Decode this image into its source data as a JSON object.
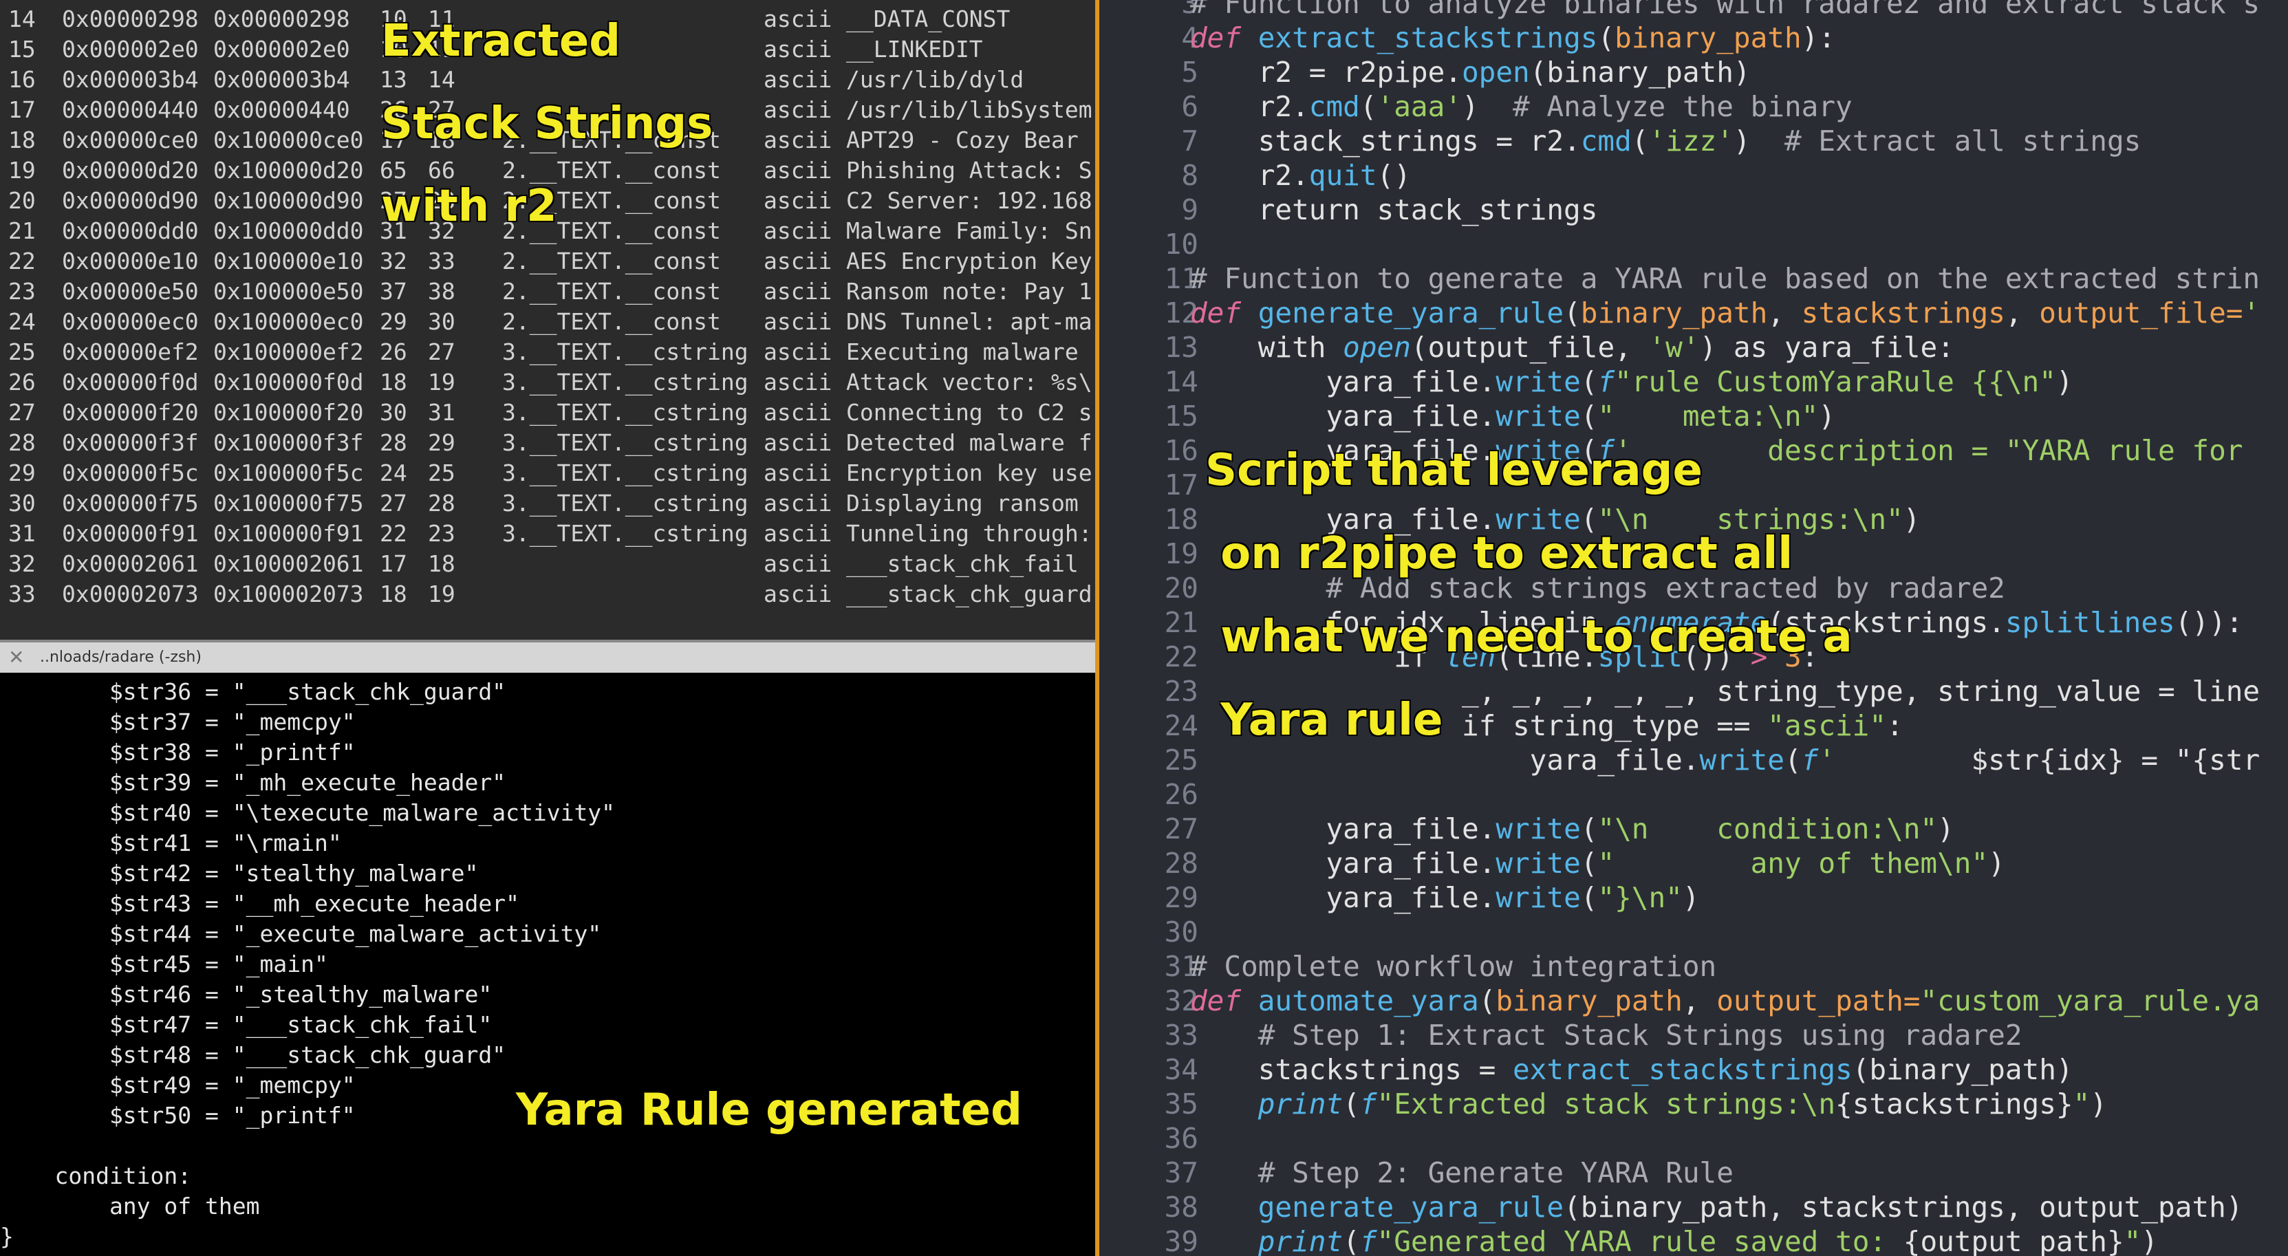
{
  "strings_table": {
    "rows": [
      {
        "idx": "14",
        "paddr": "0x00000298",
        "vaddr": "0x00000298",
        "len": "10",
        "size": "11",
        "section": "",
        "type": "ascii",
        "string": "__DATA_CONST"
      },
      {
        "idx": "15",
        "paddr": "0x000002e0",
        "vaddr": "0x000002e0",
        "len": "10",
        "size": "11",
        "section": "",
        "type": "ascii",
        "string": "__LINKEDIT"
      },
      {
        "idx": "16",
        "paddr": "0x000003b4",
        "vaddr": "0x000003b4",
        "len": "13",
        "size": "14",
        "section": "",
        "type": "ascii",
        "string": "/usr/lib/dyld"
      },
      {
        "idx": "17",
        "paddr": "0x00000440",
        "vaddr": "0x00000440",
        "len": "26",
        "size": "27",
        "section": "",
        "type": "ascii",
        "string": "/usr/lib/libSystem"
      },
      {
        "idx": "18",
        "paddr": "0x00000ce0",
        "vaddr": "0x100000ce0",
        "len": "17",
        "size": "18",
        "section": "2.__TEXT.__const",
        "type": "ascii",
        "string": "APT29 - Cozy Bear"
      },
      {
        "idx": "19",
        "paddr": "0x00000d20",
        "vaddr": "0x100000d20",
        "len": "65",
        "size": "66",
        "section": "2.__TEXT.__const",
        "type": "ascii",
        "string": "Phishing Attack: S"
      },
      {
        "idx": "20",
        "paddr": "0x00000d90",
        "vaddr": "0x100000d90",
        "len": "27",
        "size": "28",
        "section": "2.__TEXT.__const",
        "type": "ascii",
        "string": "C2 Server: 192.168"
      },
      {
        "idx": "21",
        "paddr": "0x00000dd0",
        "vaddr": "0x100000dd0",
        "len": "31",
        "size": "32",
        "section": "2.__TEXT.__const",
        "type": "ascii",
        "string": "Malware Family: Sn"
      },
      {
        "idx": "22",
        "paddr": "0x00000e10",
        "vaddr": "0x100000e10",
        "len": "32",
        "size": "33",
        "section": "2.__TEXT.__const",
        "type": "ascii",
        "string": "AES Encryption Key"
      },
      {
        "idx": "23",
        "paddr": "0x00000e50",
        "vaddr": "0x100000e50",
        "len": "37",
        "size": "38",
        "section": "2.__TEXT.__const",
        "type": "ascii",
        "string": "Ransom note: Pay 1"
      },
      {
        "idx": "24",
        "paddr": "0x00000ec0",
        "vaddr": "0x100000ec0",
        "len": "29",
        "size": "30",
        "section": "2.__TEXT.__const",
        "type": "ascii",
        "string": "DNS Tunnel: apt-ma"
      },
      {
        "idx": "25",
        "paddr": "0x00000ef2",
        "vaddr": "0x100000ef2",
        "len": "26",
        "size": "27",
        "section": "3.__TEXT.__cstring",
        "type": "ascii",
        "string": "Executing malware"
      },
      {
        "idx": "26",
        "paddr": "0x00000f0d",
        "vaddr": "0x100000f0d",
        "len": "18",
        "size": "19",
        "section": "3.__TEXT.__cstring",
        "type": "ascii",
        "string": "Attack vector: %s\\"
      },
      {
        "idx": "27",
        "paddr": "0x00000f20",
        "vaddr": "0x100000f20",
        "len": "30",
        "size": "31",
        "section": "3.__TEXT.__cstring",
        "type": "ascii",
        "string": "Connecting to C2 s"
      },
      {
        "idx": "28",
        "paddr": "0x00000f3f",
        "vaddr": "0x100000f3f",
        "len": "28",
        "size": "29",
        "section": "3.__TEXT.__cstring",
        "type": "ascii",
        "string": "Detected malware f"
      },
      {
        "idx": "29",
        "paddr": "0x00000f5c",
        "vaddr": "0x100000f5c",
        "len": "24",
        "size": "25",
        "section": "3.__TEXT.__cstring",
        "type": "ascii",
        "string": "Encryption key use"
      },
      {
        "idx": "30",
        "paddr": "0x00000f75",
        "vaddr": "0x100000f75",
        "len": "27",
        "size": "28",
        "section": "3.__TEXT.__cstring",
        "type": "ascii",
        "string": "Displaying ransom"
      },
      {
        "idx": "31",
        "paddr": "0x00000f91",
        "vaddr": "0x100000f91",
        "len": "22",
        "size": "23",
        "section": "3.__TEXT.__cstring",
        "type": "ascii",
        "string": "Tunneling through:"
      },
      {
        "idx": "32",
        "paddr": "0x00002061",
        "vaddr": "0x100002061",
        "len": "17",
        "size": "18",
        "section": "",
        "type": "ascii",
        "string": "___stack_chk_fail"
      },
      {
        "idx": "33",
        "paddr": "0x00002073",
        "vaddr": "0x100002073",
        "len": "18",
        "size": "19",
        "section": "",
        "type": "ascii",
        "string": "___stack_chk_guard"
      }
    ]
  },
  "terminal": {
    "title": "..nloads/radare (-zsh)",
    "close_glyph": "✕",
    "lines": [
      "        $str36 = \"___stack_chk_guard\"",
      "        $str37 = \"_memcpy\"",
      "        $str38 = \"_printf\"",
      "        $str39 = \"_mh_execute_header\"",
      "        $str40 = \"\\texecute_malware_activity\"",
      "        $str41 = \"\\rmain\"",
      "        $str42 = \"stealthy_malware\"",
      "        $str43 = \"__mh_execute_header\"",
      "        $str44 = \"_execute_malware_activity\"",
      "        $str45 = \"_main\"",
      "        $str46 = \"_stealthy_malware\"",
      "        $str47 = \"___stack_chk_fail\"",
      "        $str48 = \"___stack_chk_guard\"",
      "        $str49 = \"_memcpy\"",
      "        $str50 = \"_printf\"",
      "",
      "    condition:",
      "        any of them",
      "}"
    ]
  },
  "editor": {
    "lines": [
      {
        "n": "3",
        "t": [
          [
            "cmt",
            "# Function to analyze binaries with radare2 and extract stack s"
          ]
        ]
      },
      {
        "n": "4",
        "t": [
          [
            "kw",
            "def "
          ],
          [
            "fn",
            "extract_stackstrings"
          ],
          [
            "",
            "("
          ],
          [
            "prm",
            "binary_path"
          ],
          [
            "",
            "):"
          ]
        ]
      },
      {
        "n": "5",
        "t": [
          [
            "",
            "    r2 = r2pipe."
          ],
          [
            "fn",
            "open"
          ],
          [
            "",
            "(binary_path)"
          ]
        ]
      },
      {
        "n": "6",
        "t": [
          [
            "",
            "    r2."
          ],
          [
            "fn",
            "cmd"
          ],
          [
            "",
            "("
          ],
          [
            "str",
            "'aaa'"
          ],
          [
            "",
            ")  "
          ],
          [
            "cmt",
            "# Analyze the binary"
          ]
        ]
      },
      {
        "n": "7",
        "t": [
          [
            "",
            "    stack_strings = r2."
          ],
          [
            "fn",
            "cmd"
          ],
          [
            "",
            "("
          ],
          [
            "str",
            "'izz'"
          ],
          [
            "",
            ")  "
          ],
          [
            "cmt",
            "# Extract all strings"
          ]
        ]
      },
      {
        "n": "8",
        "t": [
          [
            "",
            "    r2."
          ],
          [
            "fn",
            "quit"
          ],
          [
            "",
            "()"
          ]
        ]
      },
      {
        "n": "9",
        "t": [
          [
            "",
            "    return stack_strings"
          ]
        ]
      },
      {
        "n": "10",
        "t": []
      },
      {
        "n": "11",
        "t": [
          [
            "cmt",
            "# Function to generate a YARA rule based on the extracted strin"
          ]
        ]
      },
      {
        "n": "12",
        "t": [
          [
            "kw",
            "def "
          ],
          [
            "fn",
            "generate_yara_rule"
          ],
          [
            "",
            "("
          ],
          [
            "prm",
            "binary_path"
          ],
          [
            "",
            ", "
          ],
          [
            "prm",
            "stackstrings"
          ],
          [
            "",
            ", "
          ],
          [
            "prm",
            "output_file="
          ],
          [
            "str",
            "'"
          ]
        ]
      },
      {
        "n": "13",
        "t": [
          [
            "",
            "    with "
          ],
          [
            "bi",
            "open"
          ],
          [
            "",
            "(output_file, "
          ],
          [
            "str",
            "'w'"
          ],
          [
            "",
            ") as yara_file:"
          ]
        ]
      },
      {
        "n": "14",
        "t": [
          [
            "",
            "        yara_file."
          ],
          [
            "fn",
            "write"
          ],
          [
            "",
            "("
          ],
          [
            "bi",
            "f"
          ],
          [
            "str",
            "\"rule CustomYaraRule {{\\n\""
          ],
          [
            "",
            ")"
          ]
        ]
      },
      {
        "n": "15",
        "t": [
          [
            "",
            "        yara_file."
          ],
          [
            "fn",
            "write"
          ],
          [
            "",
            "("
          ],
          [
            "str",
            "\"    meta:\\n\""
          ],
          [
            "",
            ")"
          ]
        ]
      },
      {
        "n": "16",
        "t": [
          [
            "",
            "        yara_file."
          ],
          [
            "fn",
            "write"
          ],
          [
            "",
            "("
          ],
          [
            "bi",
            "f"
          ],
          [
            "str",
            "'        description = \"YARA rule for "
          ]
        ]
      },
      {
        "n": "17",
        "t": []
      },
      {
        "n": "18",
        "t": [
          [
            "",
            "        yara_file."
          ],
          [
            "fn",
            "write"
          ],
          [
            "",
            "("
          ],
          [
            "str",
            "\"\\n    strings:\\n\""
          ],
          [
            "",
            ")"
          ]
        ]
      },
      {
        "n": "19",
        "t": []
      },
      {
        "n": "20",
        "t": [
          [
            "cmt",
            "        # Add stack strings extracted by radare2"
          ]
        ]
      },
      {
        "n": "21",
        "t": [
          [
            "",
            "        for idx, line in "
          ],
          [
            "bi",
            "enumerate"
          ],
          [
            "",
            "(stackstrings."
          ],
          [
            "fn",
            "splitlines"
          ],
          [
            "",
            "()):"
          ]
        ]
      },
      {
        "n": "22",
        "t": [
          [
            "",
            "            if "
          ],
          [
            "bi",
            "len"
          ],
          [
            "",
            "(line."
          ],
          [
            "fn",
            "split"
          ],
          [
            "",
            "()) "
          ],
          [
            "kw",
            "> "
          ],
          [
            "prm",
            "3"
          ],
          [
            "",
            ":"
          ]
        ]
      },
      {
        "n": "23",
        "t": [
          [
            "",
            "                _, _, _, _, _, string_type, string_value = line"
          ]
        ]
      },
      {
        "n": "24",
        "t": [
          [
            "",
            "                if string_type == "
          ],
          [
            "str",
            "\"ascii\""
          ],
          [
            "",
            ":"
          ]
        ]
      },
      {
        "n": "25",
        "t": [
          [
            "",
            "                    yara_file."
          ],
          [
            "fn",
            "write"
          ],
          [
            "",
            "("
          ],
          [
            "bi",
            "f"
          ],
          [
            "str",
            "'        "
          ],
          [
            "",
            "$str{idx} = \"{str"
          ]
        ]
      },
      {
        "n": "26",
        "t": []
      },
      {
        "n": "27",
        "t": [
          [
            "",
            "        yara_file."
          ],
          [
            "fn",
            "write"
          ],
          [
            "",
            "("
          ],
          [
            "str",
            "\"\\n    condition:\\n\""
          ],
          [
            "",
            ")"
          ]
        ]
      },
      {
        "n": "28",
        "t": [
          [
            "",
            "        yara_file."
          ],
          [
            "fn",
            "write"
          ],
          [
            "",
            "("
          ],
          [
            "str",
            "\"        any of them\\n\""
          ],
          [
            "",
            ")"
          ]
        ]
      },
      {
        "n": "29",
        "t": [
          [
            "",
            "        yara_file."
          ],
          [
            "fn",
            "write"
          ],
          [
            "",
            "("
          ],
          [
            "str",
            "\"}\\n\""
          ],
          [
            "",
            ")"
          ]
        ]
      },
      {
        "n": "30",
        "t": []
      },
      {
        "n": "31",
        "t": [
          [
            "cmt",
            "# Complete workflow integration"
          ]
        ]
      },
      {
        "n": "32",
        "t": [
          [
            "kw",
            "def "
          ],
          [
            "fn",
            "automate_yara"
          ],
          [
            "",
            "("
          ],
          [
            "prm",
            "binary_path"
          ],
          [
            "",
            ", "
          ],
          [
            "prm",
            "output_path="
          ],
          [
            "str",
            "\"custom_yara_rule.ya"
          ]
        ]
      },
      {
        "n": "33",
        "t": [
          [
            "cmt",
            "    # Step 1: Extract Stack Strings using radare2"
          ]
        ]
      },
      {
        "n": "34",
        "t": [
          [
            "",
            "    stackstrings = "
          ],
          [
            "fn",
            "extract_stackstrings"
          ],
          [
            "",
            "(binary_path)"
          ]
        ]
      },
      {
        "n": "35",
        "t": [
          [
            "",
            "    "
          ],
          [
            "bi",
            "print"
          ],
          [
            "",
            "("
          ],
          [
            "bi",
            "f"
          ],
          [
            "str",
            "\"Extracted stack strings:\\n"
          ],
          [
            "",
            "{stackstrings}"
          ],
          [
            "str",
            "\""
          ],
          [
            "",
            ")"
          ]
        ]
      },
      {
        "n": "36",
        "t": []
      },
      {
        "n": "37",
        "t": [
          [
            "cmt",
            "    # Step 2: Generate YARA Rule"
          ]
        ]
      },
      {
        "n": "38",
        "t": [
          [
            "",
            "    "
          ],
          [
            "fn",
            "generate_yara_rule"
          ],
          [
            "",
            "(binary_path, stackstrings, output_path)"
          ]
        ]
      },
      {
        "n": "39",
        "t": [
          [
            "",
            "    "
          ],
          [
            "bi",
            "print"
          ],
          [
            "",
            "("
          ],
          [
            "bi",
            "f"
          ],
          [
            "str",
            "\"Generated YARA rule saved to: "
          ],
          [
            "",
            "{output_path}"
          ],
          [
            "str",
            "\""
          ],
          [
            "",
            ")"
          ]
        ]
      }
    ]
  },
  "captions": {
    "extracted": "Extracted\nStack Strings\nwith r2",
    "script": "Script that leverage\n on r2pipe to extract all\n what we need to create a\n Yara rule",
    "yara_generated": "Yara Rule generated"
  },
  "colors": {
    "caption": "#f4ec24",
    "divider": "#e0951e",
    "editor_bg": "#2a2c34",
    "terminal_bg": "#000000",
    "table_bg": "#2b2b2b"
  }
}
